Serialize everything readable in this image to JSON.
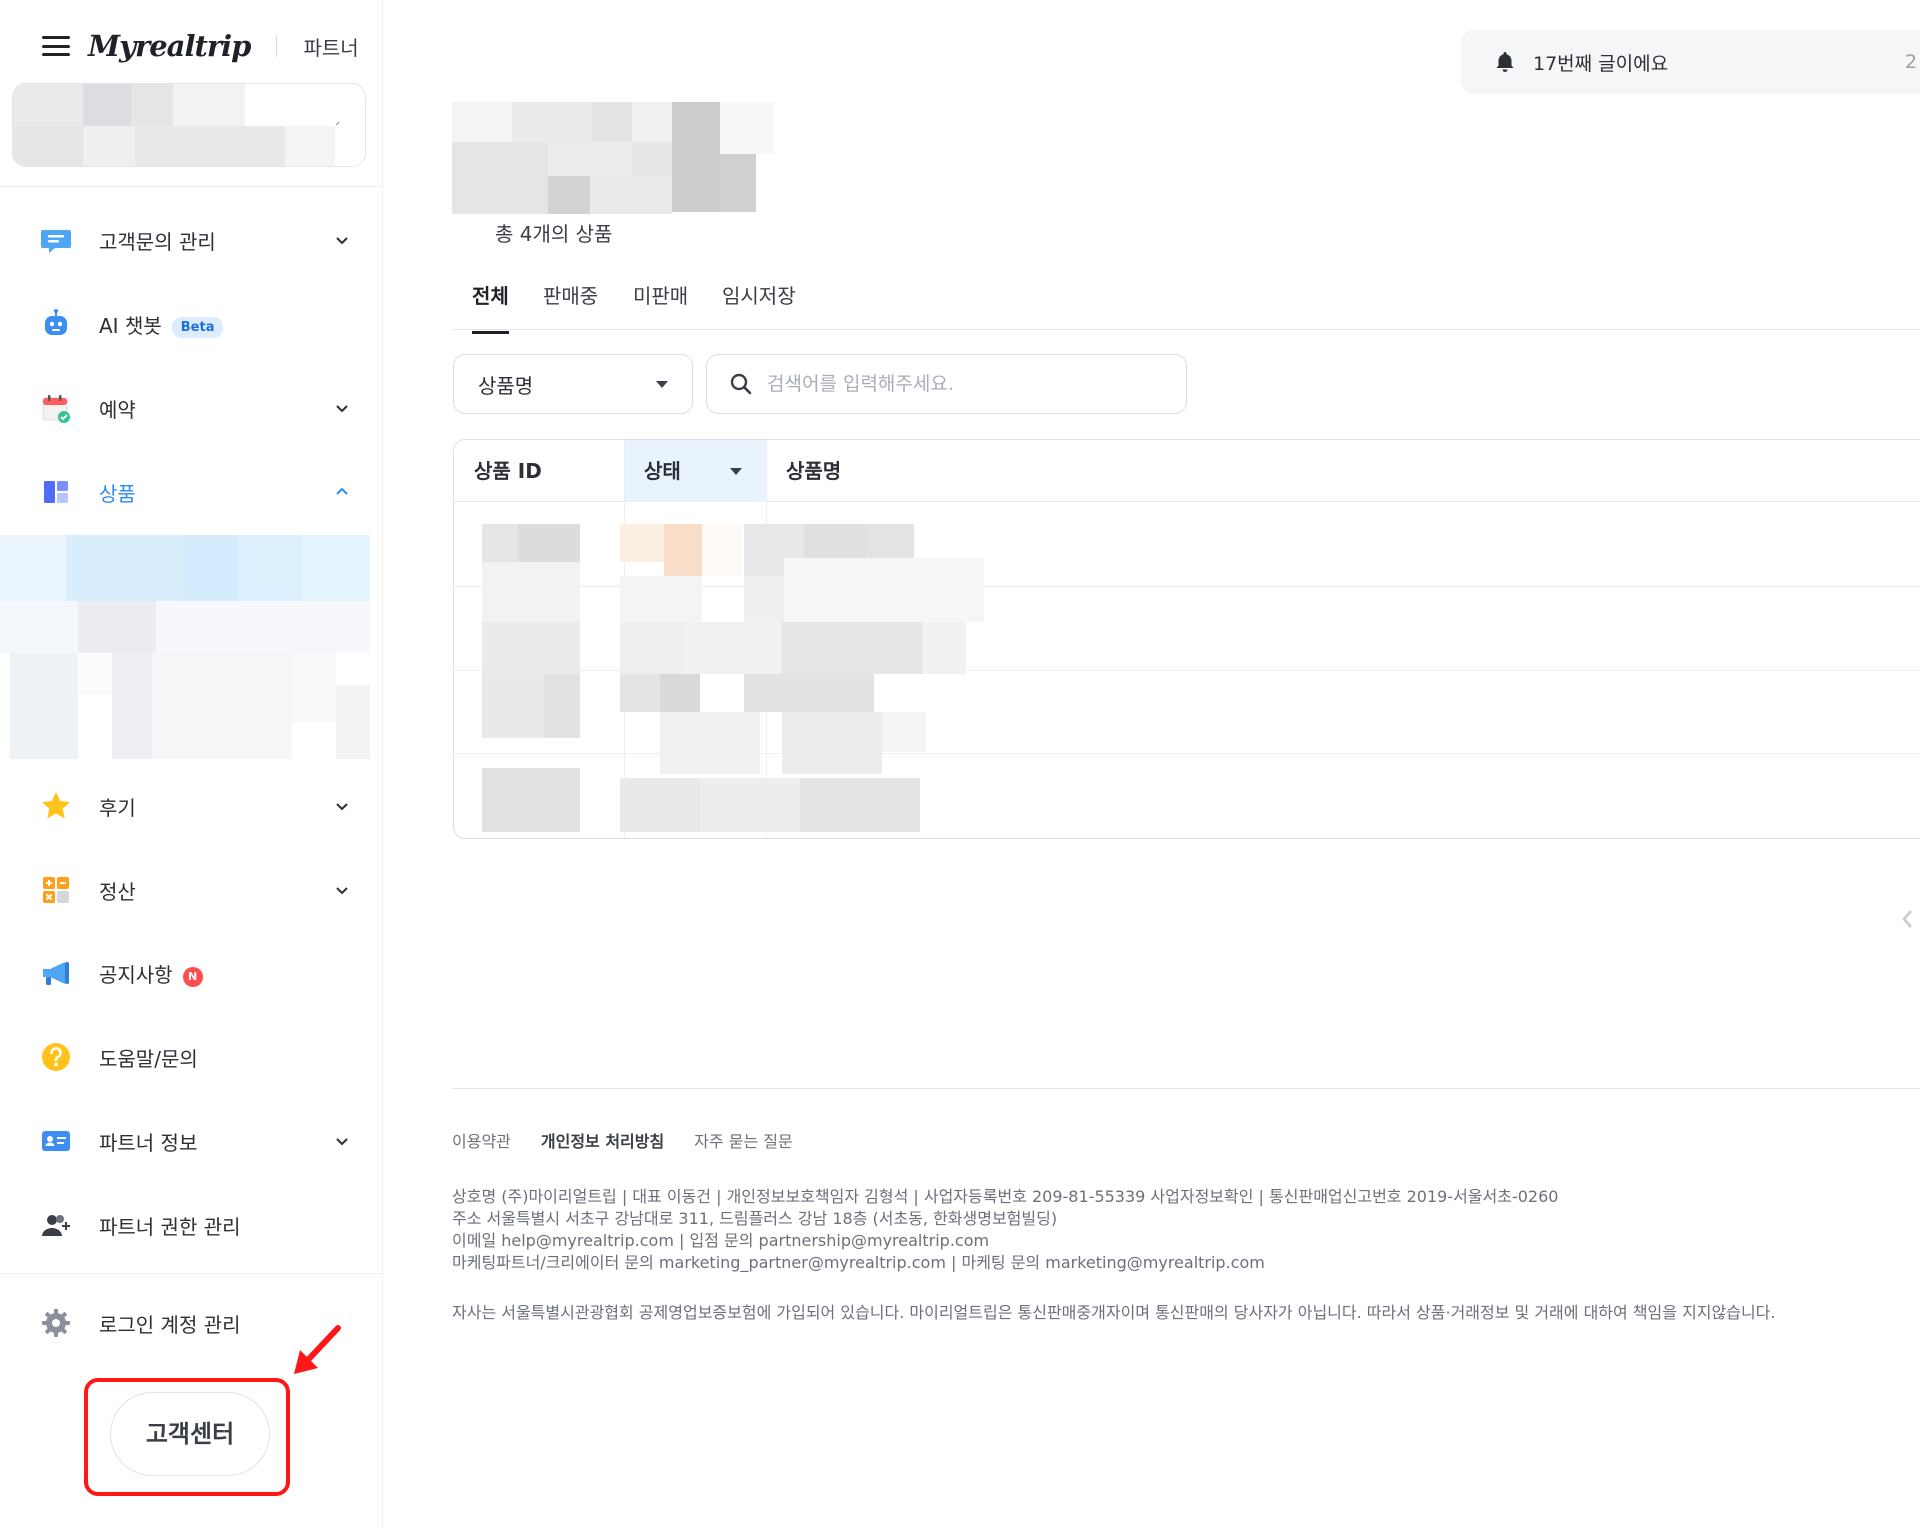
{
  "header": {
    "logo": "Myrealtrip",
    "partner_label": "파트너"
  },
  "sidebar": {
    "items": [
      {
        "label": "고객문의 관리"
      },
      {
        "label": "AI 챗봇",
        "badge": "Beta"
      },
      {
        "label": "예약"
      },
      {
        "label": "상품",
        "active": true
      },
      {
        "label": "후기"
      },
      {
        "label": "정산"
      },
      {
        "label": "공지사항",
        "badge": "N"
      },
      {
        "label": "도움말/문의"
      },
      {
        "label": "파트너 정보"
      },
      {
        "label": "파트너 권한 관리"
      }
    ],
    "account_settings": "로그인 계정 관리",
    "support_button": "고객센터"
  },
  "notice": {
    "text": "17번째 글이에요",
    "extra": "2"
  },
  "main": {
    "total_count": "총 4개의 상품",
    "tabs": [
      {
        "label": "전체",
        "active": true
      },
      {
        "label": "판매중"
      },
      {
        "label": "미판매"
      },
      {
        "label": "임시저장"
      }
    ],
    "filter_select": "상품명",
    "search_placeholder": "검색어를 입력해주세요.",
    "table": {
      "columns": [
        "상품 ID",
        "상태",
        "상품명"
      ]
    }
  },
  "footer": {
    "links": [
      "이용약관",
      "개인정보 처리방침",
      "자주 묻는 질문"
    ],
    "info": [
      "상호명 (주)마이리얼트립 | 대표 이동건 | 개인정보보호책임자 김형석 | 사업자등록번호 209-81-55339 사업자정보확인 | 통신판매업신고번호 2019-서울서초-0260",
      "주소 서울특별시 서초구 강남대로 311, 드림플러스 강남 18층 (서초동, 한화생명보험빌딩)",
      "이메일 help@myrealtrip.com | 입점 문의 partnership@myrealtrip.com",
      "마케팅파트너/크리에이터 문의 marketing_partner@myrealtrip.com | 마케팅 문의 marketing@myrealtrip.com"
    ],
    "disclaimer": "자사는 서울특별시관광협회 공제영업보증보험에 가입되어 있습니다. 마이리얼트립은 통신판매중개자이며 통신판매의 당사자가 아닙니다. 따라서 상품·거래정보 및 거래에 대하여 책임을 지지않습니다."
  },
  "colors": {
    "accent": "#2b8cf0",
    "highlight_red": "#ff1616",
    "active_row_bg": "#e3f1fd",
    "status_header_bg": "#e9f3fd"
  }
}
